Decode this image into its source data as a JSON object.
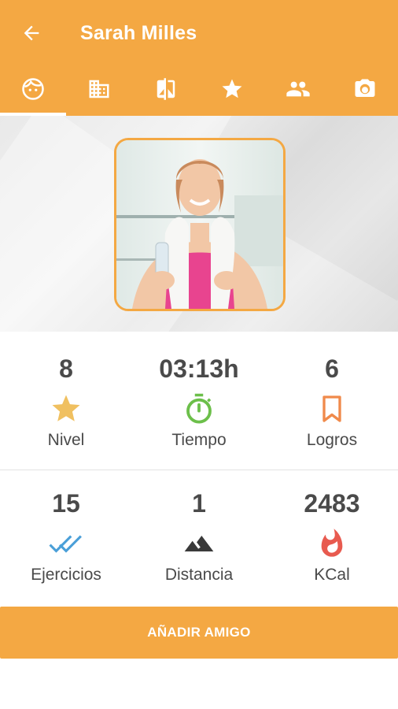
{
  "header": {
    "title": "Sarah Milles",
    "background_color": "#f4a843"
  },
  "tabs": [
    {
      "icon": "face-icon",
      "active": true
    },
    {
      "icon": "building-icon",
      "active": false
    },
    {
      "icon": "compare-icon",
      "active": false
    },
    {
      "icon": "star-icon",
      "active": false
    },
    {
      "icon": "people-icon",
      "active": false
    },
    {
      "icon": "camera-icon",
      "active": false
    }
  ],
  "profile": {
    "photo_icon": "profile-photo"
  },
  "stats": [
    {
      "value": "8",
      "label": "Nivel",
      "icon": "star-icon",
      "color": "#f0c060"
    },
    {
      "value": "03:13h",
      "label": "Tiempo",
      "icon": "stopwatch-icon",
      "color": "#6cbf4a"
    },
    {
      "value": "6",
      "label": "Logros",
      "icon": "bookmark-icon",
      "color": "#f08a4b"
    },
    {
      "value": "15",
      "label": "Ejercicios",
      "icon": "double-check-icon",
      "color": "#4a9fd8"
    },
    {
      "value": "1",
      "label": "Distancia",
      "icon": "mountain-icon",
      "color": "#3a3a3a"
    },
    {
      "value": "2483",
      "label": "KCal",
      "icon": "flame-icon",
      "color": "#e85a4f"
    }
  ],
  "actions": {
    "add_friend_label": "AÑADIR AMIGO"
  }
}
